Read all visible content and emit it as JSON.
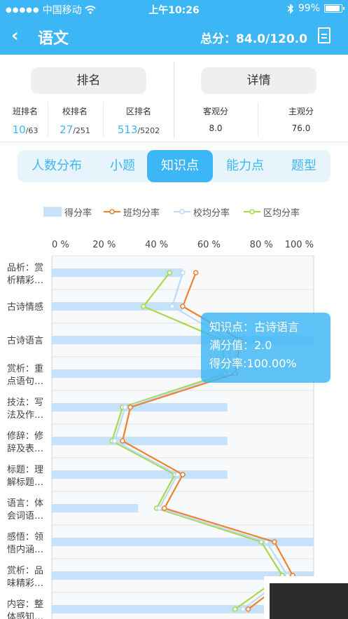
{
  "status_bar": {
    "carrier": "中国移动",
    "time": "上午10:26",
    "battery": "99%"
  },
  "header": {
    "title": "语文",
    "score": "总分：84.0/120.0"
  },
  "summary": {
    "left_button": "排名",
    "right_button": "详情",
    "ranks": [
      {
        "label": "班排名",
        "value": "10",
        "total": "/63"
      },
      {
        "label": "校排名",
        "value": "27",
        "total": "/251"
      },
      {
        "label": "区排名",
        "value": "513",
        "total": "/5202"
      }
    ],
    "scores": [
      {
        "label": "客观分",
        "value": "8.0"
      },
      {
        "label": "主观分",
        "value": "76.0"
      }
    ]
  },
  "tabs": [
    {
      "label": "人数分布",
      "active": false
    },
    {
      "label": "小题",
      "active": false
    },
    {
      "label": "知识点",
      "active": true
    },
    {
      "label": "能力点",
      "active": false
    },
    {
      "label": "题型",
      "active": false
    }
  ],
  "tooltip": {
    "line1": "知识点：古诗语言",
    "line2": "满分值：2.0",
    "line3": "得分率:100.00%"
  },
  "colors": {
    "accent": "#3db6f5",
    "bar": "#c6e2fb",
    "class": "#f0812f",
    "school": "#bcdcf9",
    "district": "#a8d94a"
  },
  "chart_data": {
    "type": "bar",
    "orientation": "horizontal",
    "xlim": [
      0,
      100
    ],
    "x_ticks": [
      "0 %",
      "20 %",
      "40 %",
      "60 %",
      "80 %",
      "100 %"
    ],
    "legend": [
      "得分率",
      "班均分率",
      "校均分率",
      "区均分率"
    ],
    "categories": [
      [
        "品析：赏",
        "析精彩…"
      ],
      [
        "古诗情感"
      ],
      [
        "古诗语言"
      ],
      [
        "赏析：重",
        "点语句…"
      ],
      [
        "技法：写",
        "法及作…"
      ],
      [
        "修辞：修",
        "辞及表…"
      ],
      [
        "标题：理",
        "解标题…"
      ],
      [
        "语言：体",
        "会词语…"
      ],
      [
        "感悟：领",
        "悟内涵…"
      ],
      [
        "赏析：品",
        "味精彩…"
      ],
      [
        "内容：整",
        "体感知…"
      ]
    ],
    "series": [
      {
        "name": "得分率",
        "values": [
          50,
          50,
          100,
          67,
          67,
          67,
          67,
          33,
          100,
          100,
          100
        ]
      },
      {
        "name": "班均分率",
        "values": [
          55,
          50,
          72,
          70,
          30,
          27,
          50,
          43,
          85,
          92,
          75
        ]
      },
      {
        "name": "校均分率",
        "values": [
          50,
          46,
          68,
          68,
          28,
          24,
          48,
          41,
          82,
          90,
          73
        ]
      },
      {
        "name": "区均分率",
        "values": [
          45,
          35,
          65,
          66,
          27,
          23,
          47,
          40,
          80,
          88,
          70
        ]
      }
    ]
  }
}
